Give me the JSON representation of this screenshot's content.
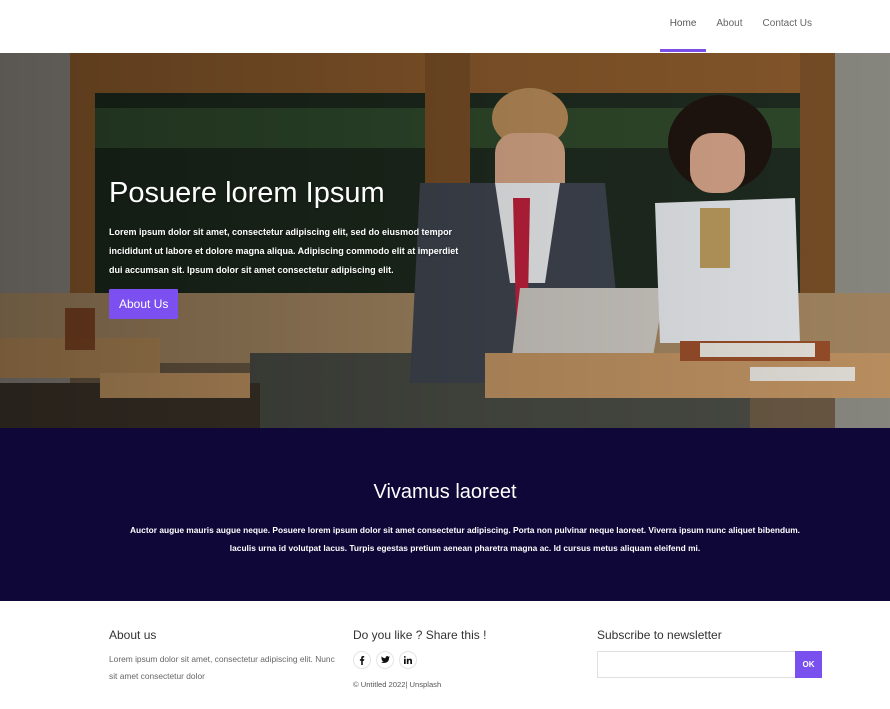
{
  "nav": {
    "links": [
      {
        "label": "Home",
        "active": true
      },
      {
        "label": "About",
        "active": false
      },
      {
        "label": "Contact Us",
        "active": false
      }
    ]
  },
  "hero": {
    "title": "Posuere lorem Ipsum",
    "text": "Lorem ipsum dolor sit amet, consectetur adipiscing elit, sed do eiusmod tempor incididunt ut labore et dolore magna aliqua. Adipiscing commodo elit at imperdiet dui accumsan sit. Ipsum dolor sit amet consectetur adipiscing elit.",
    "button_label": "About Us"
  },
  "band": {
    "title": "Vivamus laoreet",
    "text": "Auctor augue mauris augue neque. Posuere lorem ipsum dolor sit amet consectetur adipiscing. Porta non pulvinar neque laoreet. Viverra ipsum nunc aliquet bibendum. Iaculis urna id volutpat lacus. Turpis egestas pretium aenean pharetra magna ac. Id cursus metus aliquam eleifend mi."
  },
  "footer": {
    "about": {
      "heading": "About us",
      "text": "Lorem ipsum dolor sit amet, consectetur adipiscing elit. Nunc sit amet consectetur dolor"
    },
    "share": {
      "heading": "Do you like ? Share this !",
      "icons": [
        "facebook-icon",
        "twitter-icon",
        "linkedin-icon"
      ],
      "copyright": "© Untitled 2022| Unsplash"
    },
    "newsletter": {
      "heading": "Subscribe to newsletter",
      "input_value": "",
      "button_label": "OK"
    }
  },
  "colors": {
    "accent": "#7a4fe8",
    "band_background": "#0e0738"
  }
}
